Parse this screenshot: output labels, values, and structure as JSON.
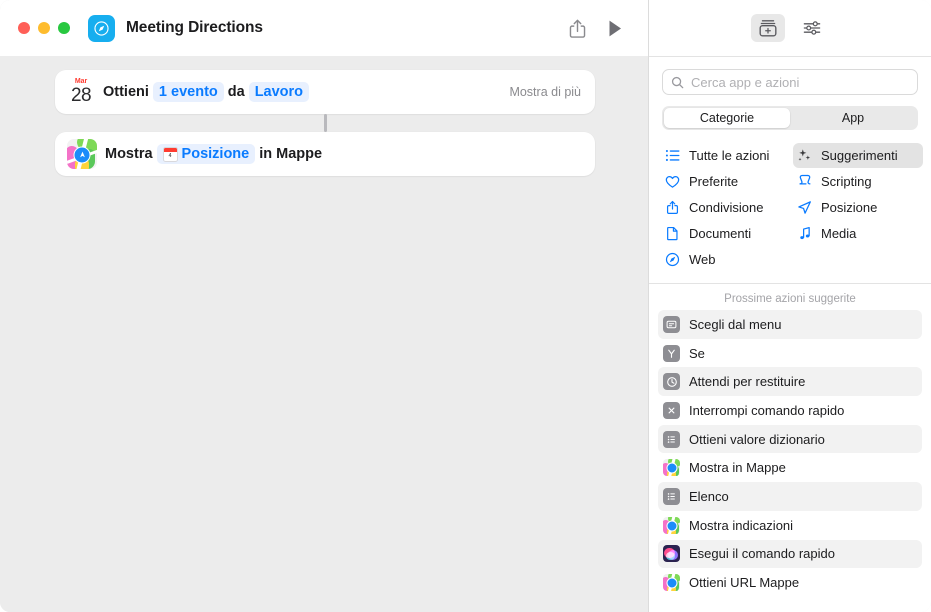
{
  "window": {
    "title": "Meeting Directions",
    "app_icon": "safari-compass-icon",
    "traffic_lights": [
      "close",
      "minimize",
      "zoom"
    ],
    "toolbar": {
      "share_label": "Condividi",
      "run_label": "Esegui"
    }
  },
  "workflow": {
    "actions": [
      {
        "icon": "calendar-icon",
        "calendar_month": "Mar",
        "calendar_day": "28",
        "parts": [
          {
            "type": "text",
            "value": "Ottieni"
          },
          {
            "type": "token",
            "value": "1 evento"
          },
          {
            "type": "text",
            "value": "da"
          },
          {
            "type": "token",
            "value": "Lavoro"
          }
        ],
        "trailing_label": "Mostra di più"
      },
      {
        "icon": "maps-app-icon",
        "parts": [
          {
            "type": "text",
            "value": "Mostra"
          },
          {
            "type": "token",
            "value": "Posizione",
            "token_icon": "mini-calendar-icon"
          },
          {
            "type": "text",
            "value": "in Mappe"
          }
        ],
        "trailing_label": ""
      }
    ]
  },
  "sidebar": {
    "toolbar": {
      "library_label": "Libreria azioni",
      "settings_label": "Impostazioni comando rapido"
    },
    "search": {
      "placeholder": "Cerca app e azioni",
      "value": "",
      "icon": "search-icon"
    },
    "segmented": {
      "options": [
        "Categorie",
        "App"
      ],
      "selected": "Categorie"
    },
    "categories": [
      {
        "label": "Tutte le azioni",
        "icon": "list-icon",
        "selected": false
      },
      {
        "label": "Suggerimenti",
        "icon": "sparkles-icon",
        "selected": true
      },
      {
        "label": "Preferite",
        "icon": "heart-icon",
        "selected": false
      },
      {
        "label": "Scripting",
        "icon": "scroll-icon",
        "selected": false
      },
      {
        "label": "Condivisione",
        "icon": "share-icon",
        "selected": false
      },
      {
        "label": "Posizione",
        "icon": "location-arrow-icon",
        "selected": false
      },
      {
        "label": "Documenti",
        "icon": "document-icon",
        "selected": false
      },
      {
        "label": "Media",
        "icon": "music-note-icon",
        "selected": false
      },
      {
        "label": "Web",
        "icon": "compass-icon",
        "selected": false
      }
    ],
    "suggestions_header": "Prossime azioni suggerite",
    "suggestions": [
      {
        "label": "Scegli dal menu",
        "icon": "menu-square-icon"
      },
      {
        "label": "Se",
        "icon": "branch-square-icon"
      },
      {
        "label": "Attendi per restituire",
        "icon": "clock-square-icon"
      },
      {
        "label": "Interrompi comando rapido",
        "icon": "x-square-icon"
      },
      {
        "label": "Ottieni valore dizionario",
        "icon": "list-square-icon"
      },
      {
        "label": "Mostra in Mappe",
        "icon": "maps-app-icon"
      },
      {
        "label": "Elenco",
        "icon": "list-square-icon"
      },
      {
        "label": "Mostra indicazioni",
        "icon": "maps-app-icon"
      },
      {
        "label": "Esegui il comando rapido",
        "icon": "shortcuts-app-icon"
      },
      {
        "label": "Ottieni URL Mappe",
        "icon": "maps-app-icon"
      }
    ]
  },
  "colors": {
    "accent_blue": "#0a7bff",
    "token_bg": "#e8f0fe",
    "canvas_bg": "#ececec",
    "card_bg": "#ffffff",
    "row_alt_bg": "#f2f2f2",
    "selected_bg": "#e3e3e3"
  }
}
